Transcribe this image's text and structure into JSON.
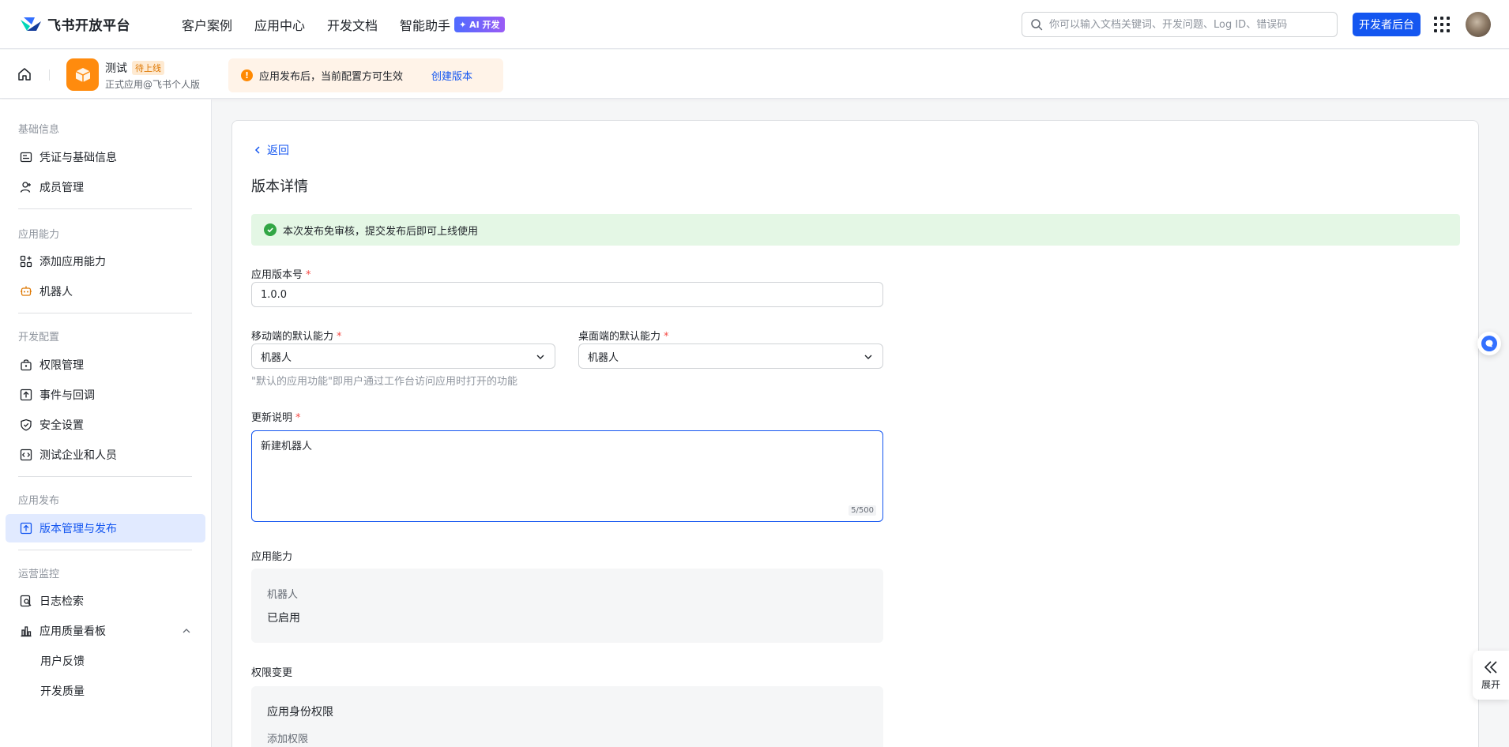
{
  "topbar": {
    "brand": "飞书开放平台",
    "nav": [
      {
        "label": "客户案例"
      },
      {
        "label": "应用中心"
      },
      {
        "label": "开发文档"
      },
      {
        "label": "智能助手",
        "badge": "✦ AI 开发"
      }
    ],
    "search_placeholder": "你可以输入文档关键词、开发问题、Log ID、错误码",
    "dev_console_label": "开发者后台"
  },
  "app_header": {
    "app_name": "测试",
    "app_status": "待上线",
    "app_type": "正式应用@飞书个人版",
    "notice_text": "应用发布后，当前配置方可生效",
    "notice_link": "创建版本"
  },
  "sidebar": {
    "groups": [
      {
        "label": "基础信息",
        "items": [
          {
            "label": "凭证与基础信息",
            "icon": "credential-icon"
          },
          {
            "label": "成员管理",
            "icon": "member-icon"
          }
        ]
      },
      {
        "label": "应用能力",
        "items": [
          {
            "label": "添加应用能力",
            "icon": "add-capability-icon"
          },
          {
            "label": "机器人",
            "icon": "robot-icon"
          }
        ]
      },
      {
        "label": "开发配置",
        "items": [
          {
            "label": "权限管理",
            "icon": "permission-icon"
          },
          {
            "label": "事件与回调",
            "icon": "event-icon"
          },
          {
            "label": "安全设置",
            "icon": "security-icon"
          },
          {
            "label": "测试企业和人员",
            "icon": "test-icon"
          }
        ]
      },
      {
        "label": "应用发布",
        "items": [
          {
            "label": "版本管理与发布",
            "icon": "version-icon",
            "active": true
          }
        ]
      },
      {
        "label": "运营监控",
        "items": [
          {
            "label": "日志检索",
            "icon": "log-search-icon"
          },
          {
            "label": "应用质量看板",
            "icon": "chart-icon"
          },
          {
            "label": "用户反馈"
          },
          {
            "label": "开发质量"
          }
        ]
      }
    ]
  },
  "main": {
    "back_label": "返回",
    "title": "版本详情",
    "success_text": "本次发布免审核，提交发布后即可上线使用",
    "version_label": "应用版本号",
    "version_value": "1.0.0",
    "mobile_default_label": "移动端的默认能力",
    "mobile_default_value": "机器人",
    "desktop_default_label": "桌面端的默认能力",
    "desktop_default_value": "机器人",
    "default_hint": "\"默认的应用功能\"即用户通过工作台访问应用时打开的功能",
    "release_notes_label": "更新说明",
    "release_notes_value": "新建机器人",
    "release_notes_count": "5/500",
    "capability_section": "应用能力",
    "capability_name": "机器人",
    "capability_status": "已启用",
    "permission_section": "权限变更",
    "permission_type": "应用身份权限",
    "permission_action": "添加权限"
  },
  "float": {
    "expand_label": "展开"
  },
  "colors": {
    "primary": "#1456f0",
    "success_bg": "#e4f7e5",
    "warning_bg": "#fff3e8",
    "app_icon": "#ff8b0e"
  }
}
